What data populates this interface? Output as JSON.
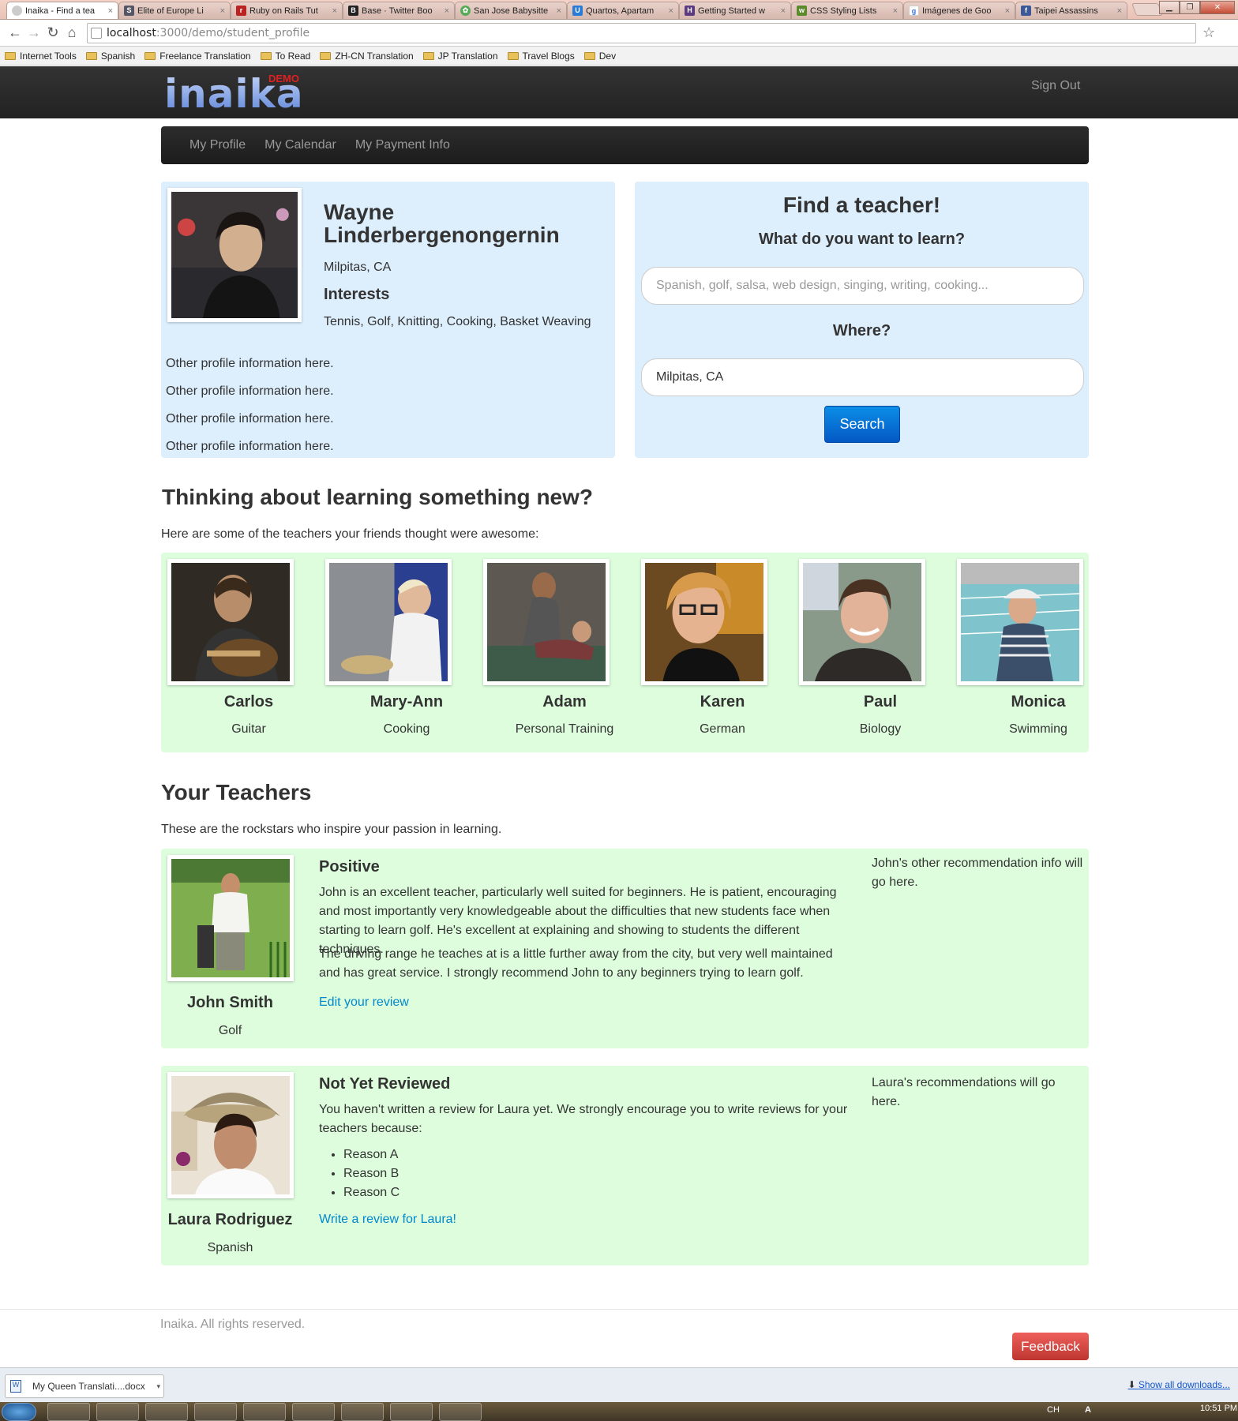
{
  "browser": {
    "tabs": [
      {
        "title": "Inaika - Find a tea",
        "favicon": "page-icon",
        "active": true
      },
      {
        "title": "Elite of Europe Li",
        "favicon": "s-icon"
      },
      {
        "title": "Ruby on Rails Tut",
        "favicon": "rails-icon"
      },
      {
        "title": "Base · Twitter Boo",
        "favicon": "b-icon"
      },
      {
        "title": "San Jose Babysitte",
        "favicon": "flower-icon"
      },
      {
        "title": "Quartos, Apartam",
        "favicon": "u-icon"
      },
      {
        "title": "Getting Started w",
        "favicon": "h-icon"
      },
      {
        "title": "CSS Styling Lists",
        "favicon": "w3-icon"
      },
      {
        "title": "Imágenes de Goo",
        "favicon": "google-icon"
      },
      {
        "title": "Taipei Assassins",
        "favicon": "facebook-icon"
      }
    ],
    "url_host": "localhost",
    "url_path": ":3000/demo/student_profile",
    "bookmarks": [
      "Internet Tools",
      "Spanish",
      "Freelance Translation",
      "To Read",
      "ZH-CN Translation",
      "JP Translation",
      "Travel Blogs",
      "Dev"
    ]
  },
  "header": {
    "logo": "inaika",
    "logo_badge": "DEMO",
    "sign_out": "Sign Out"
  },
  "nav": [
    "My Profile",
    "My Calendar",
    "My Payment Info"
  ],
  "profile": {
    "name": "Wayne Linderbergenongernin",
    "location": "Milpitas, CA",
    "interests_heading": "Interests",
    "interests": "Tennis, Golf, Knitting, Cooking, Basket Weaving",
    "other_info": [
      "Other profile information here.",
      "Other profile information here.",
      "Other profile information here.",
      "Other profile information here."
    ]
  },
  "search": {
    "title": "Find a teacher!",
    "what_label": "What do you want to learn?",
    "what_placeholder": "Spanish, golf, salsa, web design, singing, writing, cooking...",
    "where_label": "Where?",
    "where_value": "Milpitas, CA",
    "button": "Search"
  },
  "recommended": {
    "heading": "Thinking about learning something new?",
    "subheading": "Here are some of the teachers your friends thought were awesome:",
    "teachers": [
      {
        "name": "Carlos",
        "subject": "Guitar"
      },
      {
        "name": "Mary-Ann",
        "subject": "Cooking"
      },
      {
        "name": "Adam",
        "subject": "Personal Training"
      },
      {
        "name": "Karen",
        "subject": "German"
      },
      {
        "name": "Paul",
        "subject": "Biology"
      },
      {
        "name": "Monica",
        "subject": "Swimming"
      }
    ]
  },
  "your_teachers": {
    "heading": "Your Teachers",
    "subheading": "These are the rockstars who inspire your passion in learning.",
    "john": {
      "name": "John Smith",
      "subject": "Golf",
      "review_heading": "Positive",
      "para1": "John is an excellent teacher, particularly well suited for beginners. He is patient, encouraging and most importantly very knowledgeable about the difficulties that new students face when starting to learn golf. He's excellent at explaining and showing to students the different techniques.",
      "para2": "The driving range he teaches at is a little further away from the city, but very well maintained and has great service. I strongly recommend John to any beginners trying to learn golf.",
      "link": "Edit your review",
      "side": "John's other recommendation info will go here."
    },
    "laura": {
      "name": "Laura Rodriguez",
      "subject": "Spanish",
      "review_heading": "Not Yet Reviewed",
      "para1": "You haven't written a review for Laura yet. We strongly encourage you to write reviews for your teachers because:",
      "reasons": [
        "Reason A",
        "Reason B",
        "Reason C"
      ],
      "link": "Write a review for Laura!",
      "side": "Laura's recommendations will go here."
    }
  },
  "footer": {
    "copyright": "Inaika. All rights reserved.",
    "feedback": "Feedback"
  },
  "downloads": {
    "file": "My Queen Translati....docx",
    "show_all": "Show all downloads..."
  },
  "taskbar": {
    "lang": "CH",
    "ime": "A",
    "clock": "10:51 PM"
  }
}
